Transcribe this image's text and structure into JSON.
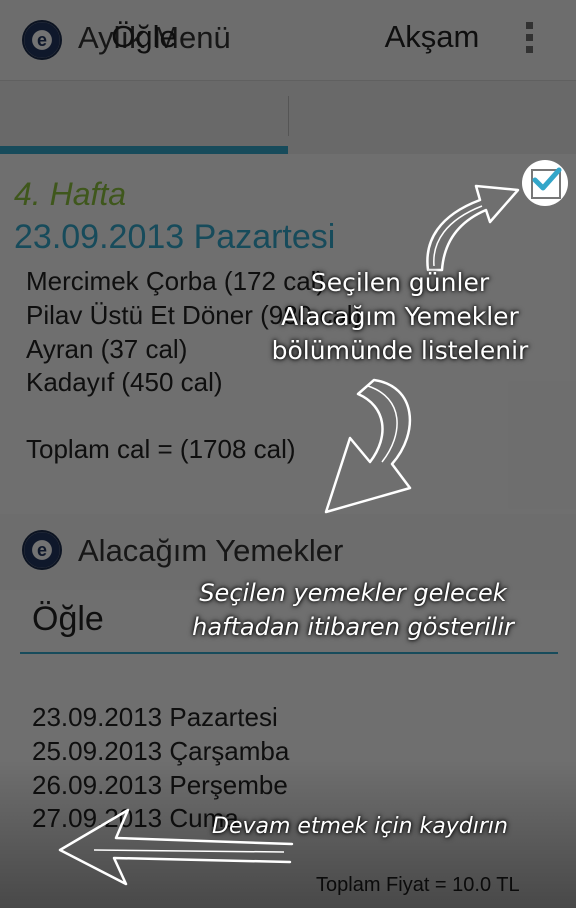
{
  "app": {
    "title": "Aylık Menü",
    "logo_letter": "e",
    "menu_icon": "overflow-menu-icon"
  },
  "tabs": [
    {
      "label": "Öğle",
      "selected": true
    },
    {
      "label": "Akşam",
      "selected": false
    }
  ],
  "menu_card": {
    "week": "4. Hafta",
    "date": "23.09.2013 Pazartesi",
    "items": [
      "Mercimek Çorba (172 cal)",
      "Pilav Üstü Et Döner (980 cal)",
      "Ayran (37 cal)",
      "Kadayıf (450 cal)"
    ],
    "total": "Toplam cal = (1708 cal)",
    "checked": true
  },
  "second_screen": {
    "title": "Alacağım Yemekler",
    "section": "Öğle",
    "days": [
      "23.09.2013 Pazartesi",
      "25.09.2013 Çarşamba",
      "26.09.2013 Perşembe",
      "27.09.2013 Cuma"
    ],
    "total_price": "Toplam Fiyat = 10.0 TL"
  },
  "tutorial": {
    "note_1_line1": "Seçilen günler",
    "note_1_line2": "Alacağım Yemekler",
    "note_1_line3": "bölümünde listelenir",
    "note_2_line1": "Seçilen yemekler gelecek",
    "note_2_line2": "haftadan itibaren gösterilir",
    "note_3": "Devam etmek için kaydırın"
  },
  "colors": {
    "accent": "#33a6c9",
    "week_green": "#8dc23e"
  }
}
